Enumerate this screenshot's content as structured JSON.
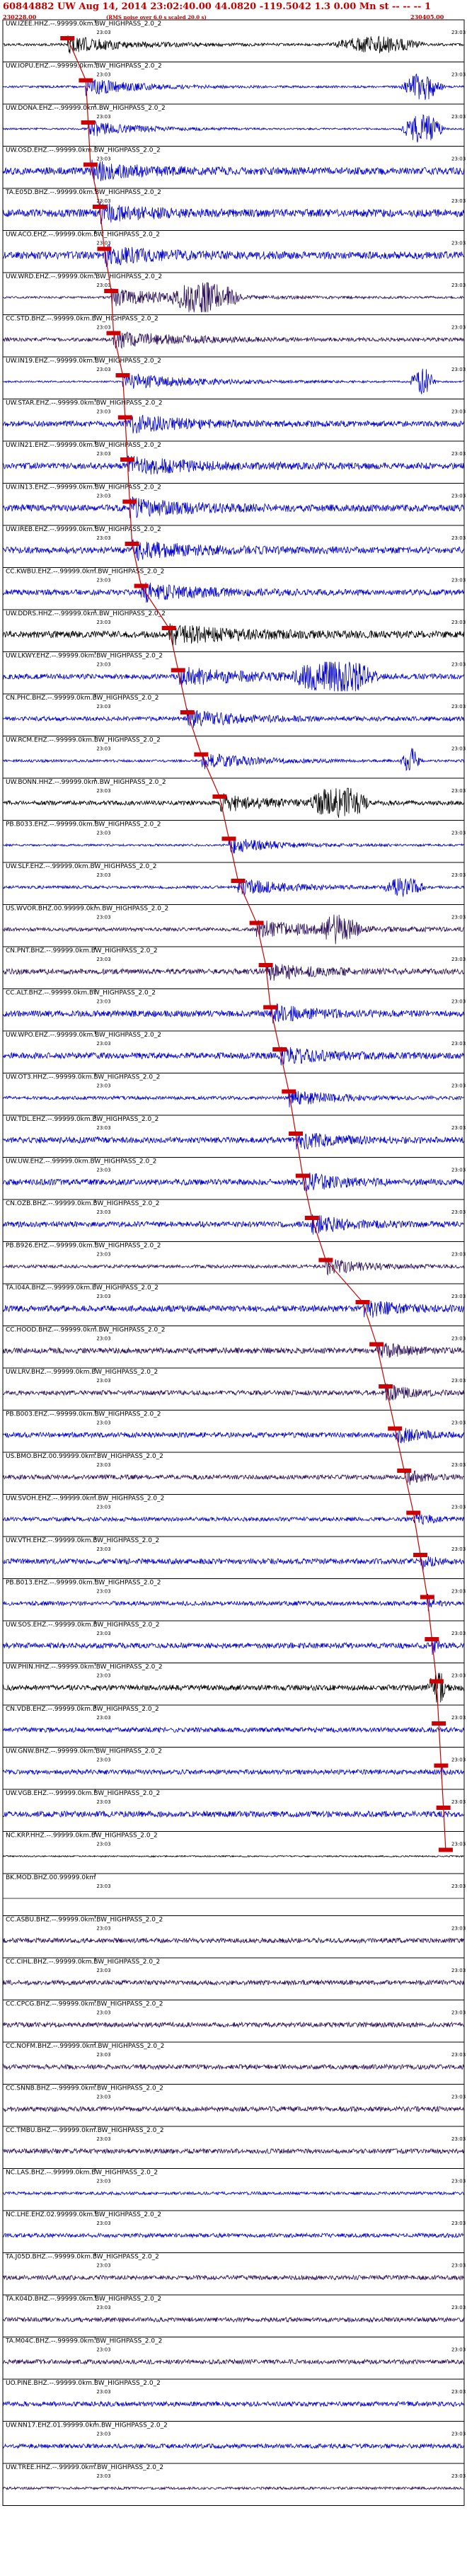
{
  "header": {
    "title": "60844882 UW Aug 14, 2014 23:02:40.00   44.0820 -119.5042   1.3 0.00 Mn st -- -- -- 1",
    "start_time": "230228.00",
    "note": "(RMS noise over 6.0 s scaled 20.0 s)",
    "end_time": "230405.00"
  },
  "chart_data": {
    "type": "line",
    "title": "60844882 UW Aug 14, 2014 23:02:40.00   44.0820 -119.5042   1.3 0.00 Mn st -- -- -- 1",
    "tick_label": "23:03",
    "marker_color": "#cc0000",
    "colors": {
      "blue": "#0000cc",
      "black": "#000000",
      "purple": "#2b0e5a"
    },
    "series": [
      {
        "name": "UW.IZEE.HHZ.--.99999.0km.BW_HIGHPASS_2.0_2",
        "color": "black",
        "pick_s": 14.0,
        "event": [
          14,
          34
        ],
        "burst": [
          70,
          22,
          0.8
        ],
        "noise": 0.14
      },
      {
        "name": "UW.IOPU.EHZ.--.99999.0km.BW_HIGHPASS_2.0_2",
        "color": "blue",
        "pick_s": 18.0,
        "event": [
          18,
          30
        ],
        "burst": [
          86,
          10,
          1.4
        ],
        "noise": 0.12
      },
      {
        "name": "UW.DONA.EHZ.--.99999.0km.BW_HIGHPASS_2.0_2",
        "color": "blue",
        "pick_s": 18.5,
        "event": [
          18.5,
          28
        ],
        "burst": [
          86,
          10,
          1.5
        ],
        "noise": 0.1
      },
      {
        "name": "UW.OSD.EHZ.--.99999.0km.BW_HIGHPASS_2.0_2",
        "color": "blue",
        "pick_s": 19.0,
        "event": [
          19,
          30
        ],
        "burst": [
          0,
          0,
          0
        ],
        "noise": 0.4
      },
      {
        "name": "TA.E05D.BHZ.--.99999.0km.BW_HIGHPASS_2.0_2",
        "color": "blue",
        "pick_s": 21.0,
        "event": [
          21,
          26
        ],
        "burst": [
          0,
          0,
          0
        ],
        "noise": 0.42
      },
      {
        "name": "UW.ACO.EHZ.--.99999.0km.BW_HIGHPASS_2.0_2",
        "color": "blue",
        "pick_s": 22.0,
        "event": [
          22,
          30
        ],
        "burst": [
          0,
          0,
          0
        ],
        "noise": 0.4
      },
      {
        "name": "UW.WRD.EHZ.--.99999.0km.BW_HIGHPASS_2.0_2",
        "color": "purple",
        "pick_s": 23.5,
        "event": [
          23.5,
          45
        ],
        "burst": [
          36,
          16,
          1.6
        ],
        "noise": 0.12
      },
      {
        "name": "CC.STD.BHZ.--.99999.0km.BW_HIGHPASS_2.0_2",
        "color": "purple",
        "pick_s": 24.0,
        "event": [
          24,
          40
        ],
        "burst": [
          0,
          0,
          0
        ],
        "noise": 0.2
      },
      {
        "name": "UW.IN19.EHZ.--.99999.0km.BW_HIGHPASS_2.0_2",
        "color": "blue",
        "pick_s": 26.0,
        "event": [
          26,
          42
        ],
        "burst": [
          88,
          6,
          1.4
        ],
        "noise": 0.1
      },
      {
        "name": "UW.STAR.EHZ.--.99999.0km.BW_HIGHPASS_2.0_2",
        "color": "blue",
        "pick_s": 26.5,
        "event": [
          26.5,
          40
        ],
        "burst": [
          0,
          0,
          0
        ],
        "noise": 0.3
      },
      {
        "name": "UW.IN21.EHZ.--.99999.0km.BW_HIGHPASS_2.0_2",
        "color": "blue",
        "pick_s": 27.0,
        "event": [
          27,
          40
        ],
        "burst": [
          0,
          0,
          0
        ],
        "noise": 0.34
      },
      {
        "name": "UW.IN13.EHZ.--.99999.0km.BW_HIGHPASS_2.0_2",
        "color": "blue",
        "pick_s": 27.5,
        "event": [
          27.5,
          38
        ],
        "burst": [
          0,
          0,
          0
        ],
        "noise": 0.36
      },
      {
        "name": "UW.IREB.EHZ.--.99999.0km.BW_HIGHPASS_2.0_2",
        "color": "blue",
        "pick_s": 28.0,
        "event": [
          28,
          36
        ],
        "burst": [
          0,
          0,
          0
        ],
        "noise": 0.36
      },
      {
        "name": "CC.KWBU.EHZ.--.99999.0km.BW_HIGHPASS_2.0_2",
        "color": "blue",
        "pick_s": 30.0,
        "event": [
          30,
          36
        ],
        "burst": [
          0,
          0,
          0
        ],
        "noise": 0.3
      },
      {
        "name": "UW.DDRS.HHZ.--.99999.0km.BW_HIGHPASS_2.0_2",
        "color": "black",
        "pick_s": 36.0,
        "event": [
          36,
          44
        ],
        "burst": [
          0,
          0,
          0
        ],
        "noise": 0.36
      },
      {
        "name": "UW.LKWY.EHZ.--.99999.0km.BW_HIGHPASS_2.0_2",
        "color": "blue",
        "pick_s": 38.0,
        "event": [
          38,
          42
        ],
        "burst": [
          62,
          20,
          1.7
        ],
        "noise": 0.28
      },
      {
        "name": "CN.PHC.BHZ.--.99999.0km.BW_HIGHPASS_2.0_2",
        "color": "blue",
        "pick_s": 40.0,
        "event": [
          40,
          30
        ],
        "burst": [
          0,
          0,
          0
        ],
        "noise": 0.24
      },
      {
        "name": "UW.RCM.EHZ.--.99999.0km.BW_HIGHPASS_2.0_2",
        "color": "blue",
        "pick_s": 43.0,
        "event": [
          43,
          30
        ],
        "burst": [
          86,
          5,
          1.3
        ],
        "noise": 0.14
      },
      {
        "name": "UW.BONN.HHZ.--.99999.0km.BW_HIGHPASS_2.0_2",
        "color": "black",
        "pick_s": 47.0,
        "event": [
          47,
          30
        ],
        "burst": [
          66,
          14,
          1.6
        ],
        "noise": 0.24
      },
      {
        "name": "PB.B033.EHZ.--.99999.0km.BW_HIGHPASS_2.0_2",
        "color": "blue",
        "pick_s": 49.0,
        "event": [
          49,
          26
        ],
        "burst": [
          0,
          0,
          0
        ],
        "noise": 0.12
      },
      {
        "name": "UW.SLF.EHZ.--.99999.0km.BW_HIGHPASS_2.0_2",
        "color": "blue",
        "pick_s": 51.0,
        "event": [
          51,
          28
        ],
        "burst": [
          82,
          10,
          0.9
        ],
        "noise": 0.16
      },
      {
        "name": "US.WVOR.BHZ.00.99999.0km.BW_HIGHPASS_2.0_2",
        "color": "purple",
        "pick_s": 55.0,
        "event": [
          55,
          40
        ],
        "burst": [
          68,
          10,
          1.3
        ],
        "noise": 0.2
      },
      {
        "name": "CN.PNT.BHZ.--.99999.0km.BW_HIGHPASS_2.0_2",
        "color": "purple",
        "pick_s": 57.0,
        "event": [
          57,
          26
        ],
        "burst": [
          0,
          0,
          0
        ],
        "noise": 0.3
      },
      {
        "name": "CC.ALT.BHZ.--.99999.0km.BW_HIGHPASS_2.0_2",
        "color": "blue",
        "pick_s": 58.0,
        "event": [
          58,
          24
        ],
        "burst": [
          0,
          0,
          0
        ],
        "noise": 0.34
      },
      {
        "name": "UW.WPO.EHZ.--.99999.0km.BW_HIGHPASS_2.0_2",
        "color": "blue",
        "pick_s": 60.0,
        "event": [
          60,
          24
        ],
        "burst": [
          0,
          0,
          0
        ],
        "noise": 0.34
      },
      {
        "name": "UW.OT3.HHZ.--.99999.0km.BW_HIGHPASS_2.0_2",
        "color": "blue",
        "pick_s": 62.0,
        "event": [
          62,
          26
        ],
        "burst": [
          0,
          0,
          0
        ],
        "noise": 0.18
      },
      {
        "name": "UW.TDL.EHZ.--.99999.0km.BW_HIGHPASS_2.0_2",
        "color": "blue",
        "pick_s": 63.5,
        "event": [
          63.5,
          24
        ],
        "burst": [
          0,
          0,
          0
        ],
        "noise": 0.32
      },
      {
        "name": "UW.UW.EHZ.--.99999.0km.BW_HIGHPASS_2.0_2",
        "color": "blue",
        "pick_s": 65.0,
        "event": [
          65,
          22
        ],
        "burst": [
          0,
          0,
          0
        ],
        "noise": 0.32
      },
      {
        "name": "CN.OZB.BHZ.--.99999.0km.BW_HIGHPASS_2.0_2",
        "color": "blue",
        "pick_s": 67.0,
        "event": [
          67,
          22
        ],
        "burst": [
          0,
          0,
          0
        ],
        "noise": 0.3
      },
      {
        "name": "PB.B926.EHZ.--.99999.0km.BW_HIGHPASS_2.0_2",
        "color": "purple",
        "pick_s": 70.0,
        "event": [
          70,
          22
        ],
        "burst": [
          0,
          0,
          0
        ],
        "noise": 0.18
      },
      {
        "name": "TA.I04A.BHZ.--.99999.0km.BW_HIGHPASS_2.0_2",
        "color": "blue",
        "pick_s": 78.0,
        "event": [
          78,
          20
        ],
        "burst": [
          0,
          0,
          0
        ],
        "noise": 0.34
      },
      {
        "name": "CC.HOOD.BHZ.--.99999.0km.BW_HIGHPASS_2.0_2",
        "color": "purple",
        "pick_s": 81.0,
        "event": [
          81,
          16
        ],
        "burst": [
          0,
          0,
          0
        ],
        "noise": 0.3
      },
      {
        "name": "UW.LRV.BHZ.--.99999.0km.BW_HIGHPASS_2.0_2",
        "color": "purple",
        "pick_s": 83.0,
        "event": [
          83,
          14
        ],
        "burst": [
          0,
          0,
          0
        ],
        "noise": 0.26
      },
      {
        "name": "PB.B003.EHZ.--.99999.0km.BW_HIGHPASS_2.0_2",
        "color": "blue",
        "pick_s": 85.0,
        "event": [
          85,
          14
        ],
        "burst": [
          0,
          0,
          0
        ],
        "noise": 0.28
      },
      {
        "name": "US.BMO.BHZ.00.99999.0km.BW_HIGHPASS_2.0_2",
        "color": "purple",
        "pick_s": 87.0,
        "event": [
          87,
          10
        ],
        "burst": [
          0,
          0,
          0
        ],
        "noise": 0.24
      },
      {
        "name": "UW.SVOH.EHZ.--.99999.0km.BW_HIGHPASS_2.0_2",
        "color": "blue",
        "pick_s": 89.0,
        "event": [
          89,
          8
        ],
        "burst": [
          0,
          0,
          0
        ],
        "noise": 0.22
      },
      {
        "name": "UW.VTH.EHZ.--.99999.0km.BW_HIGHPASS_2.0_2",
        "color": "blue",
        "pick_s": 90.5,
        "event": [
          90.5,
          6
        ],
        "burst": [
          0,
          0,
          0
        ],
        "noise": 0.3
      },
      {
        "name": "PB.B013.EHZ.--.99999.0km.BW_HIGHPASS_2.0_2",
        "color": "blue",
        "pick_s": 92.0,
        "event": [
          92,
          4
        ],
        "burst": [
          0,
          0,
          0
        ],
        "noise": 0.24
      },
      {
        "name": "UW.SOS.EHZ.--.99999.0km.BW_HIGHPASS_2.0_2",
        "color": "blue",
        "pick_s": 93.0,
        "event": [
          93,
          3
        ],
        "burst": [
          0,
          0,
          0
        ],
        "noise": 0.3
      },
      {
        "name": "UW.PHIN.HHZ.--.99999.0km.BW_HIGHPASS_2.0_2",
        "color": "black",
        "pick_s": 94.0,
        "event": [
          94,
          3
        ],
        "burst": [
          92,
          4,
          1.5
        ],
        "noise": 0.3
      },
      {
        "name": "CN.VDB.EHZ.--.99999.0km.BW_HIGHPASS_2.0_2",
        "color": "blue",
        "pick_s": 94.5,
        "event": [
          0,
          0
        ],
        "burst": [
          0,
          0,
          0
        ],
        "noise": 0.26
      },
      {
        "name": "UW.GNW.BHZ.--.99999.0km.BW_HIGHPASS_2.0_2",
        "color": "blue",
        "pick_s": 95.0,
        "event": [
          95,
          2
        ],
        "burst": [
          0,
          0,
          0
        ],
        "noise": 0.26
      },
      {
        "name": "UW.VGB.EHZ.--.99999.0km.BW_HIGHPASS_2.0_2",
        "color": "blue",
        "pick_s": 95.5,
        "event": [
          0,
          0
        ],
        "burst": [
          0,
          0,
          0
        ],
        "noise": 0.32
      },
      {
        "name": "NC.KRP.HHZ.--.99999.0km.BW_HIGHPASS_2.0_2",
        "color": "black",
        "pick_s": 96.0,
        "event": [
          0,
          0
        ],
        "burst": [
          0,
          0,
          0
        ],
        "noise": 0.08
      },
      {
        "name": "BK.MOD.BHZ.00.99999.0km",
        "color": "black",
        "pick_s": null,
        "event": [
          0,
          0
        ],
        "burst": [
          0,
          0,
          0
        ],
        "noise": 0.0
      },
      {
        "name": "CC.ASBU.BHZ.--.99999.0km.BW_HIGHPASS_2.0_2",
        "color": "purple",
        "pick_s": null,
        "event": [
          0,
          0
        ],
        "burst": [
          0,
          0,
          0
        ],
        "noise": 0.26
      },
      {
        "name": "CC.CIHL.BHZ.--.99999.0km.BW_HIGHPASS_2.0_2",
        "color": "purple",
        "pick_s": null,
        "event": [
          0,
          0
        ],
        "burst": [
          0,
          0,
          0
        ],
        "noise": 0.26
      },
      {
        "name": "CC.CPCG.BHZ.--.99999.0km.BW_HIGHPASS_2.0_2",
        "color": "purple",
        "pick_s": null,
        "event": [
          0,
          0
        ],
        "burst": [
          0,
          0,
          0
        ],
        "noise": 0.26
      },
      {
        "name": "CC.NOFM.BHZ.--.99999.0km.BW_HIGHPASS_2.0_2",
        "color": "purple",
        "pick_s": null,
        "event": [
          0,
          0
        ],
        "burst": [
          0,
          0,
          0
        ],
        "noise": 0.26
      },
      {
        "name": "CC.SNNB.BHZ.--.99999.0km.BW_HIGHPASS_2.0_2",
        "color": "purple",
        "pick_s": null,
        "event": [
          0,
          0
        ],
        "burst": [
          0,
          0,
          0
        ],
        "noise": 0.26
      },
      {
        "name": "CC.TMBU.BHZ.--.99999.0km.BW_HIGHPASS_2.0_2",
        "color": "purple",
        "pick_s": null,
        "event": [
          0,
          0
        ],
        "burst": [
          0,
          0,
          0
        ],
        "noise": 0.26
      },
      {
        "name": "NC.LAS.BHZ.--.99999.0km.BW_HIGHPASS_2.0_2",
        "color": "blue",
        "pick_s": null,
        "event": [
          0,
          0
        ],
        "burst": [
          0,
          0,
          0
        ],
        "noise": 0.16
      },
      {
        "name": "NC.LHE.EHZ.02.99999.0km.BW_HIGHPASS_2.0_2",
        "color": "blue",
        "pick_s": null,
        "event": [
          0,
          0
        ],
        "burst": [
          0,
          0,
          0
        ],
        "noise": 0.22
      },
      {
        "name": "TA.J05D.BHZ.--.99999.0km.BW_HIGHPASS_2.0_2",
        "color": "purple",
        "pick_s": null,
        "event": [
          0,
          0
        ],
        "burst": [
          0,
          0,
          0
        ],
        "noise": 0.24
      },
      {
        "name": "TA.K04D.BHZ.--.99999.0km.BW_HIGHPASS_2.0_2",
        "color": "purple",
        "pick_s": null,
        "event": [
          0,
          0
        ],
        "burst": [
          0,
          0,
          0
        ],
        "noise": 0.24
      },
      {
        "name": "TA.M04C.BHZ.--.99999.0km.BW_HIGHPASS_2.0_2",
        "color": "purple",
        "pick_s": null,
        "event": [
          0,
          0
        ],
        "burst": [
          0,
          0,
          0
        ],
        "noise": 0.24
      },
      {
        "name": "UO.PINE.BHZ.--.99999.0km.BW_HIGHPASS_2.0_2",
        "color": "blue",
        "pick_s": null,
        "event": [
          0,
          0
        ],
        "burst": [
          0,
          0,
          0
        ],
        "noise": 0.26
      },
      {
        "name": "UW.NN17.EHZ.01.99999.0km.BW_HIGHPASS_2.0_2",
        "color": "blue",
        "pick_s": null,
        "event": [
          0,
          0
        ],
        "burst": [
          0,
          0,
          0
        ],
        "noise": 0.24
      },
      {
        "name": "UW.TREE.HHZ.--.99999.0km.BW_HIGHPASS_2.0_2",
        "color": "purple",
        "pick_s": null,
        "event": [
          0,
          0
        ],
        "burst": [
          0,
          0,
          0
        ],
        "noise": 0.14
      }
    ]
  }
}
